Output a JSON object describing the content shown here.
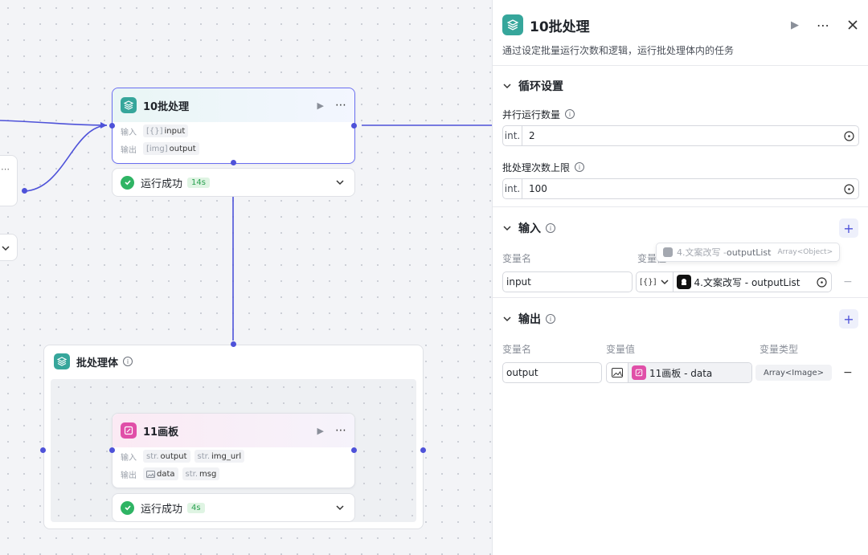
{
  "canvas": {
    "batch_node": {
      "title": "10批处理",
      "input_label": "输入",
      "output_label": "输出",
      "input_type": "[{}]",
      "input_name": "input",
      "output_type": "[img]",
      "output_name": "output"
    },
    "batch_status": {
      "text": "运行成功",
      "duration": "14s"
    },
    "group": {
      "title": "批处理体"
    },
    "draw_node": {
      "title": "11画板",
      "input_label": "输入",
      "output_label": "输出",
      "inputs": [
        {
          "type": "str.",
          "name": "output"
        },
        {
          "type": "str.",
          "name": "img_url"
        }
      ],
      "outputs": [
        {
          "type": "img",
          "name": "data"
        },
        {
          "type": "str.",
          "name": "msg"
        }
      ]
    },
    "draw_status": {
      "text": "运行成功",
      "duration": "4s"
    }
  },
  "panel": {
    "title": "10批处理",
    "description": "通过设定批量运行次数和逻辑，运行批处理体内的任务",
    "loop_section": {
      "title": "循环设置",
      "parallel_label": "并行运行数量",
      "parallel_type": "int.",
      "parallel_value": "2",
      "limit_label": "批处理次数上限",
      "limit_type": "int.",
      "limit_value": "100"
    },
    "input_section": {
      "title": "输入",
      "col_name": "变量名",
      "col_value": "变量值",
      "var_name": "input",
      "value_type_icon": "[{}]",
      "value_text": "4.文案改写 - outputList",
      "tooltip_source": "4.文案改写 - ",
      "tooltip_field": "outputList",
      "tooltip_type": "Array<Object>"
    },
    "output_section": {
      "title": "输出",
      "col_name": "变量名",
      "col_value": "变量值",
      "col_type": "变量类型",
      "var_name": "output",
      "value_text": "11画板 - data",
      "var_type": "Array<Image>"
    }
  },
  "colors": {
    "accent": "#4e52d9",
    "teal": "#36a69b",
    "pink": "#e04fa8",
    "success": "#2fb464"
  }
}
